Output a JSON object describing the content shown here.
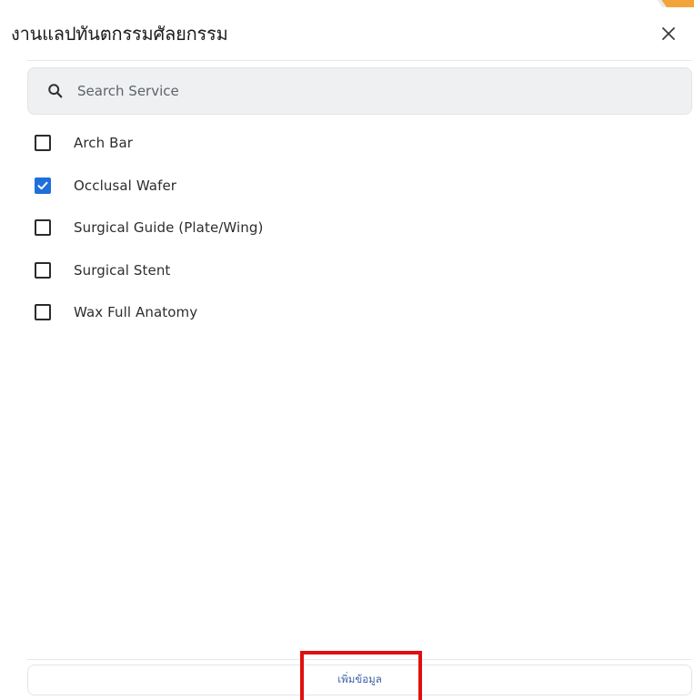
{
  "dialog": {
    "title": "งานแลปทันตกรรมศัลยกรรม",
    "close_icon": "close-icon"
  },
  "search": {
    "placeholder": "Search Service",
    "value": "",
    "icon": "search-icon"
  },
  "services": [
    {
      "label": "Arch Bar",
      "checked": false
    },
    {
      "label": "Occlusal Wafer",
      "checked": true
    },
    {
      "label": "Surgical Guide (Plate/Wing)",
      "checked": false
    },
    {
      "label": "Surgical Stent",
      "checked": false
    },
    {
      "label": "Wax Full Anatomy",
      "checked": false
    }
  ],
  "footer": {
    "add_label": "เพิ่มข้อมูล"
  },
  "colors": {
    "accent": "#1e6fd9",
    "highlight": "#e01010",
    "corner_accent": "#f2a43a"
  }
}
